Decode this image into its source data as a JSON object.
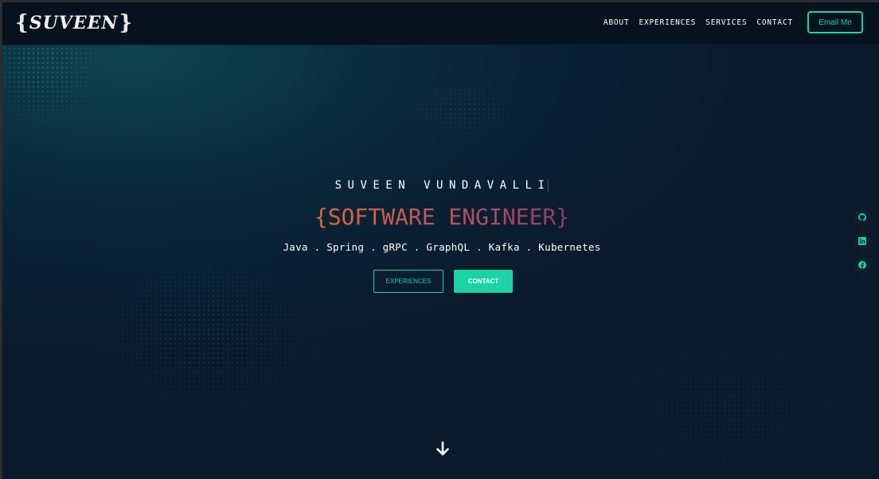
{
  "brand": {
    "brace_open": "{",
    "name": "SUVEEN",
    "brace_close": "}"
  },
  "nav": {
    "links": [
      "ABOUT",
      "EXPERIENCES",
      "SERVICES",
      "CONTACT"
    ],
    "email_button": "Email Me"
  },
  "hero": {
    "name": "SUVEEN VUNDAVALLI",
    "title": "{SOFTWARE ENGINEER}",
    "skills": "Java . Spring . gRPC . GraphQL . Kafka . Kubernetes",
    "primary_button": "EXPERIENCES",
    "secondary_button": "CONTACT"
  },
  "social": [
    {
      "icon": "github-icon"
    },
    {
      "icon": "linkedin-icon"
    },
    {
      "icon": "facebook-icon"
    }
  ],
  "colors": {
    "accent": "#1bd3a6",
    "title_gradient_start": "#e2663a",
    "title_gradient_end": "#8a3c6c",
    "navbar": "#06131f"
  }
}
